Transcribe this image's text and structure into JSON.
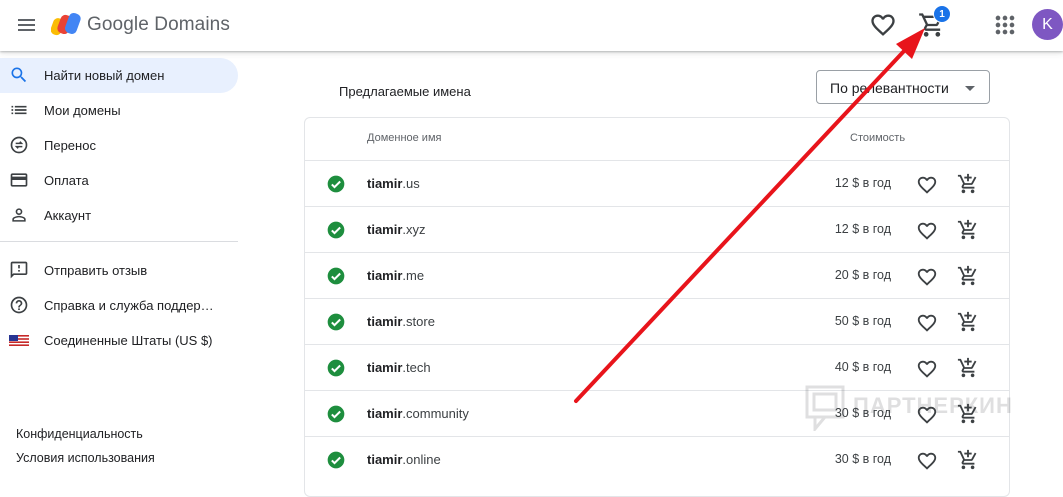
{
  "header": {
    "brand": "Google Domains",
    "cart_count": "1",
    "avatar_letter": "K",
    "icons": [
      "menu-icon",
      "favorites-heart-icon",
      "cart-icon",
      "apps-grid-icon"
    ]
  },
  "sidebar": {
    "items": [
      {
        "label": "Найти новый домен",
        "icon": "search-icon",
        "active": true
      },
      {
        "label": "Мои домены",
        "icon": "list-icon"
      },
      {
        "label": "Перенос",
        "icon": "transfer-icon"
      },
      {
        "label": "Оплата",
        "icon": "credit-card-icon"
      },
      {
        "label": "Аккаунт",
        "icon": "person-icon"
      },
      {
        "label": "Отправить отзыв",
        "icon": "feedback-icon"
      },
      {
        "label": "Справка и служба поддер…",
        "icon": "help-icon"
      },
      {
        "label": "Соединенные Штаты (US $)",
        "icon": "us-flag-icon"
      }
    ],
    "footer": {
      "privacy": "Конфиденциальность",
      "terms": "Условия использования"
    }
  },
  "main": {
    "section_title": "Предлагаемые имена",
    "sort": {
      "selected": "По релевантности"
    },
    "columns": {
      "domain": "Доменное имя",
      "price": "Стоимость"
    },
    "rows": [
      {
        "name": "tiamir",
        "tld": ".us",
        "price": "12 $ в год"
      },
      {
        "name": "tiamir",
        "tld": ".xyz",
        "price": "12 $ в год"
      },
      {
        "name": "tiamir",
        "tld": ".me",
        "price": "20 $ в год"
      },
      {
        "name": "tiamir",
        "tld": ".store",
        "price": "50 $ в год"
      },
      {
        "name": "tiamir",
        "tld": ".tech",
        "price": "40 $ в год"
      },
      {
        "name": "tiamir",
        "tld": ".community",
        "price": "30 $ в год"
      },
      {
        "name": "tiamir",
        "tld": ".online",
        "price": "30 $ в год"
      }
    ]
  },
  "watermark": {
    "text": "ПАРТНЕРКИН"
  },
  "colors": {
    "accent": "#1a73e8",
    "active_nav_bg": "#e8f0fe",
    "check_green": "#1e8e3e",
    "avatar": "#7e57c2",
    "annotation_arrow": "#e8141b"
  }
}
